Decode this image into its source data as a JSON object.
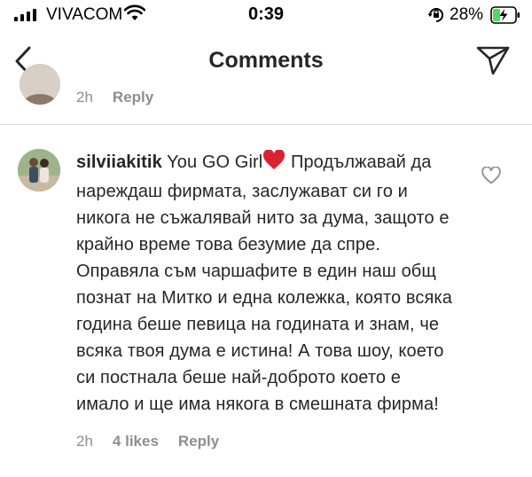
{
  "status_bar": {
    "carrier": "VIVACOM",
    "time": "0:39",
    "battery_percent": "28%",
    "signal_icon": "signal-bars-icon",
    "wifi_icon": "wifi-icon",
    "orientation_lock_icon": "orientation-lock-icon",
    "battery_icon": "battery-charging-icon",
    "battery_level": 0.28,
    "battery_color": "#4cd964"
  },
  "nav": {
    "title": "Comments",
    "back_icon": "chevron-left-icon",
    "share_icon": "paper-plane-icon"
  },
  "previous_comment": {
    "time": "2h",
    "reply_label": "Reply"
  },
  "comment": {
    "username": "silviiakitik",
    "text_start": "You GO Girl",
    "emoji": "heart-emoji",
    "text_rest": " Продължавай да нареждаш фирмата, заслужават си го и никога не съжалявай нито за дума, защото е крайно време това безумие да спре. Оправяла съм чаршафите в един наш общ познат на Митко и една колежка, която всяка година беше певица на годината и знам, че всяка твоя дума е истина! А това шоу, което си постнала беше най-доброто което е имало и ще има някога в смешната фирма!",
    "time": "2h",
    "likes": "4 likes",
    "reply_label": "Reply",
    "like_icon": "heart-outline-icon",
    "emoji_color": "#d8232f"
  },
  "colors": {
    "meta_text": "#8e8e8e",
    "body_text": "#262626",
    "divider": "#dbdbdb"
  }
}
